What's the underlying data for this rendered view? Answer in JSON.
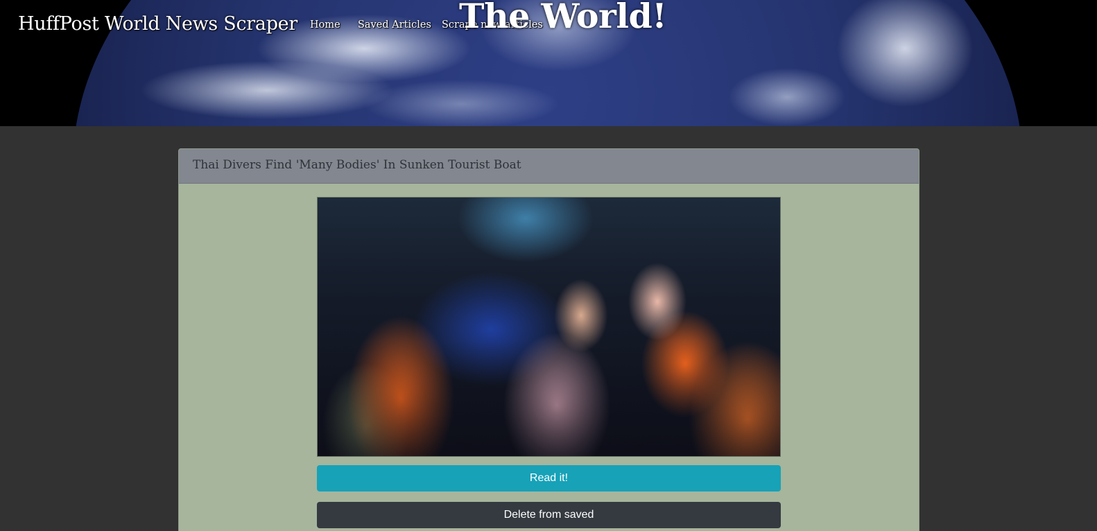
{
  "header": {
    "brand": "HuffPost World News Scraper",
    "nav": [
      {
        "label": "Home"
      },
      {
        "label": "Saved Articles"
      },
      {
        "label": "Scrape new articles"
      }
    ],
    "hero_title": "The World!"
  },
  "article": {
    "title": "Thai Divers Find 'Many Bodies' In Sunken Tourist Boat",
    "read_label": "Read it!",
    "delete_label": "Delete from saved"
  },
  "colors": {
    "page_bg": "#323232",
    "card_bg": "#a6b59c",
    "card_header_bg": "#828790",
    "read_button": "#17a2b8",
    "delete_button": "#343a40"
  }
}
